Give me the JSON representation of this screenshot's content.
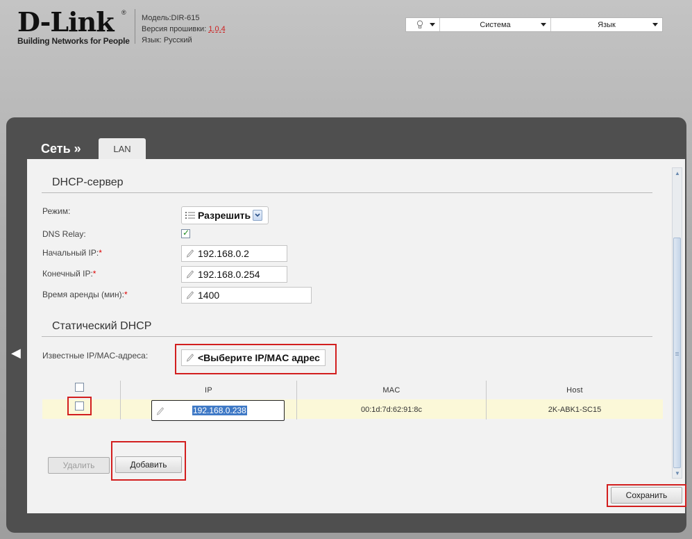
{
  "header": {
    "logo": "D-Link",
    "logo_reg": "®",
    "tagline": "Building Networks for People",
    "model_label": "Модель:",
    "model_value": "DIR-615",
    "firmware_label": "Версия прошивки:",
    "firmware_value": "1.0.4",
    "language_label": "Язык:",
    "language_value": "Русский"
  },
  "topmenu": {
    "system": "Система",
    "language": "Язык"
  },
  "nav": {
    "breadcrumb": "Сеть »",
    "tab": "LAN"
  },
  "dhcp": {
    "title": "DHCP-сервер",
    "mode_label": "Режим:",
    "mode_value": "Разрешить",
    "dns_relay_label": "DNS Relay:",
    "dns_relay_checked": true,
    "start_ip_label": "Начальный IP:",
    "start_ip_value": "192.168.0.2",
    "end_ip_label": "Конечный IP:",
    "end_ip_value": "192.168.0.254",
    "lease_label": "Время аренды (мин):",
    "lease_value": "1400",
    "required_mark": "*"
  },
  "static_dhcp": {
    "title": "Статический DHCP",
    "known_label": "Известные IP/MAC-адреса:",
    "known_value": "<Выберите IP/MAC адрес",
    "columns": [
      "IP",
      "MAC",
      "Host"
    ],
    "rows": [
      {
        "ip": "192.168.0.238",
        "mac": "00:1d:7d:62:91:8c",
        "host": "2K-ABK1-SC15"
      }
    ],
    "delete_label": "Удалить",
    "add_label": "Добавить"
  },
  "save_label": "Сохранить",
  "colors": {
    "highlight": "#d21e1e",
    "row_bg": "#fbf8d8",
    "selection": "#3f79c6"
  }
}
